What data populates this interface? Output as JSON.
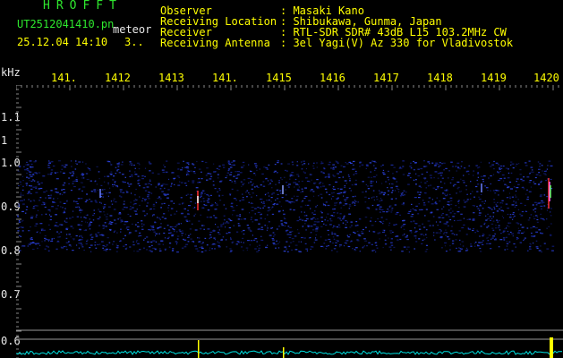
{
  "header": {
    "app_title": "HROFFT",
    "file_name": "UT2512041410.pn",
    "meteor_label": "meteor",
    "date_time": "25.12.04 14:10",
    "count": "3.."
  },
  "info": {
    "rows": [
      {
        "label": "Observer",
        "value": ": Masaki Kano"
      },
      {
        "label": "Receiving Location",
        "value": ": Shibukawa, Gunma, Japan"
      },
      {
        "label": "Receiver",
        "value": ": RTL-SDR SDR# 43dB L15 103.2MHz CW"
      },
      {
        "label": "Receiving Antenna",
        "value": ": 3el Yagi(V) Az 330 for Vladivostok"
      }
    ]
  },
  "plot": {
    "unit_label": "kHz",
    "x_ticks": [
      "141.",
      "1412",
      "1413",
      "141.",
      "1415",
      "1416",
      "1417",
      "1418",
      "1419",
      "1420"
    ],
    "y_ticks": [
      "1.1",
      "1",
      "1.0",
      "0.9",
      "0.8",
      "0.7",
      "0.6"
    ],
    "colors": {
      "noise": "#1a2a9a",
      "signal": "#ff3030",
      "baseline": "#00e0e0",
      "marker": "#ffff00"
    }
  }
}
